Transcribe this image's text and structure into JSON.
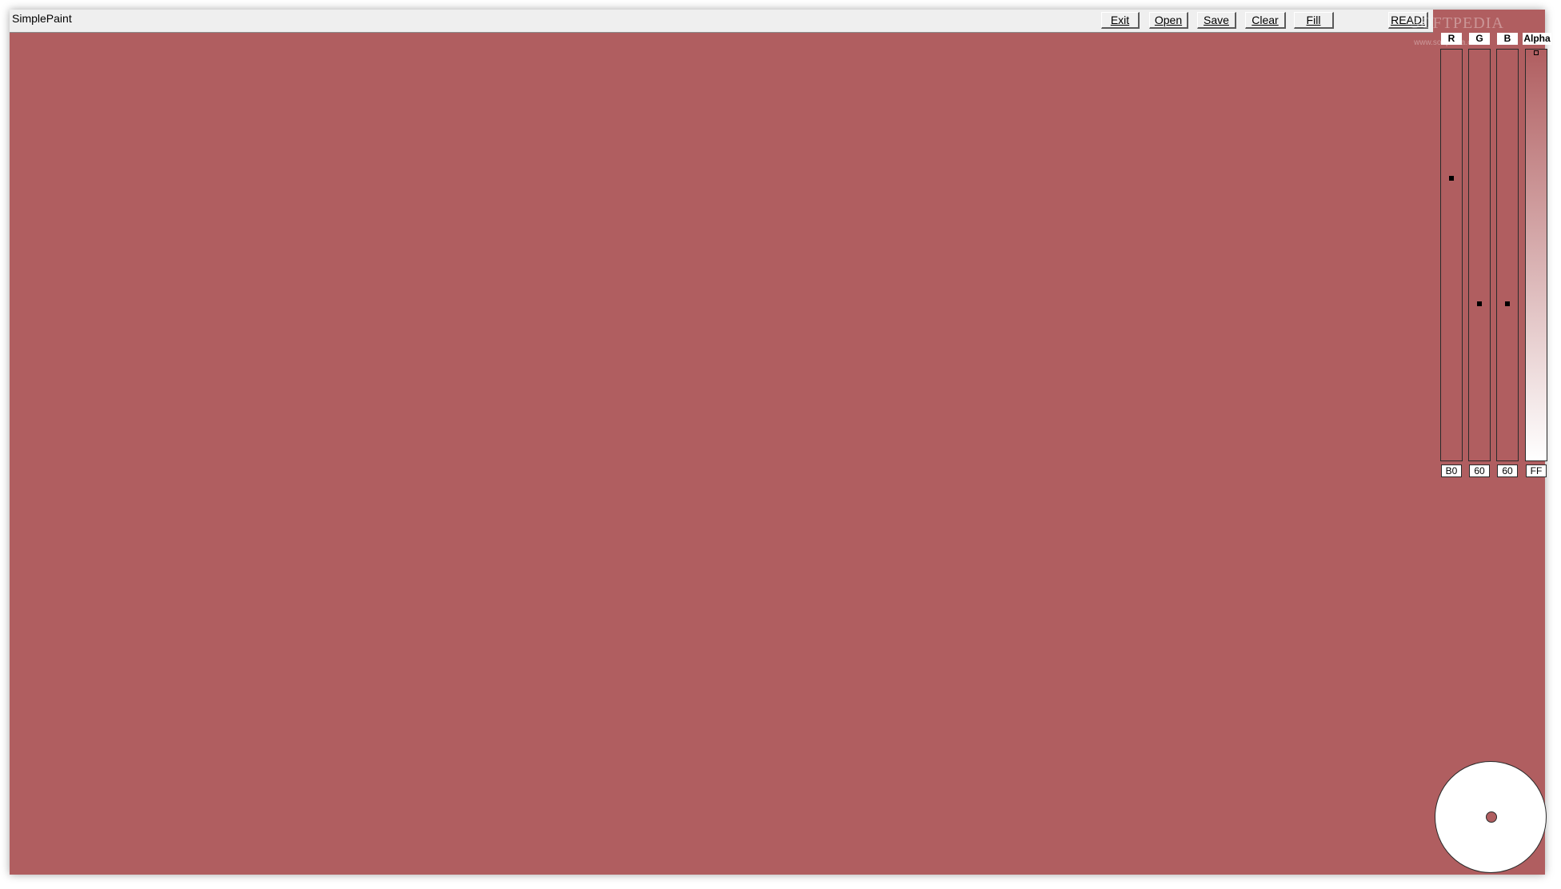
{
  "app": {
    "title": "SimplePaint"
  },
  "toolbar": {
    "exit_label": "Exit",
    "open_label": "Open",
    "save_label": "Save",
    "clear_label": "Clear",
    "fill_label": "Fill",
    "readme_label": "READ!"
  },
  "colors": {
    "canvas": "#b05e60",
    "current_color": "#b05e60"
  },
  "channels": [
    {
      "label": "R",
      "hex": "B0",
      "level": 0.69
    },
    {
      "label": "G",
      "hex": "60",
      "level": 0.38
    },
    {
      "label": "B",
      "hex": "60",
      "level": 0.38
    },
    {
      "label": "Alpha",
      "hex": "FF",
      "level": 1.0
    }
  ],
  "watermark": {
    "text": "SOFTPEDIA",
    "sub": "www.softpedia.com"
  }
}
